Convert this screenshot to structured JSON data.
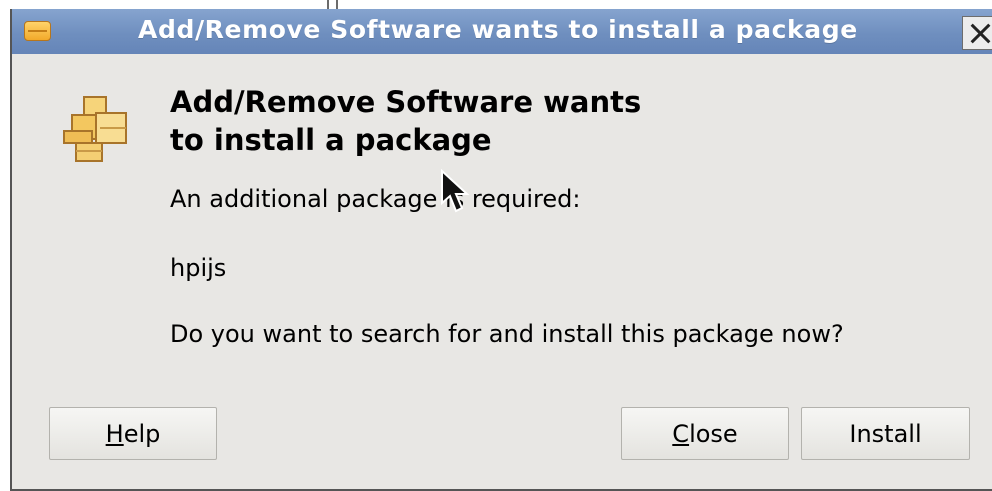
{
  "window": {
    "title": "Add/Remove Software wants to install a package"
  },
  "dialog": {
    "heading_line1": "Add/Remove Software wants",
    "heading_line2": "to install a package",
    "message": "An additional package is required:",
    "package_name": "hpijs",
    "question": "Do you want to search for and install this package now?"
  },
  "buttons": {
    "help_mnemonic": "H",
    "help_rest": "elp",
    "close_mnemonic": "C",
    "close_rest": "lose",
    "install_label": "Install"
  },
  "icons": {
    "window_menu": "window-menu-icon",
    "close": "close-icon",
    "package": "package-icon",
    "cursor": "mouse-pointer-icon"
  }
}
